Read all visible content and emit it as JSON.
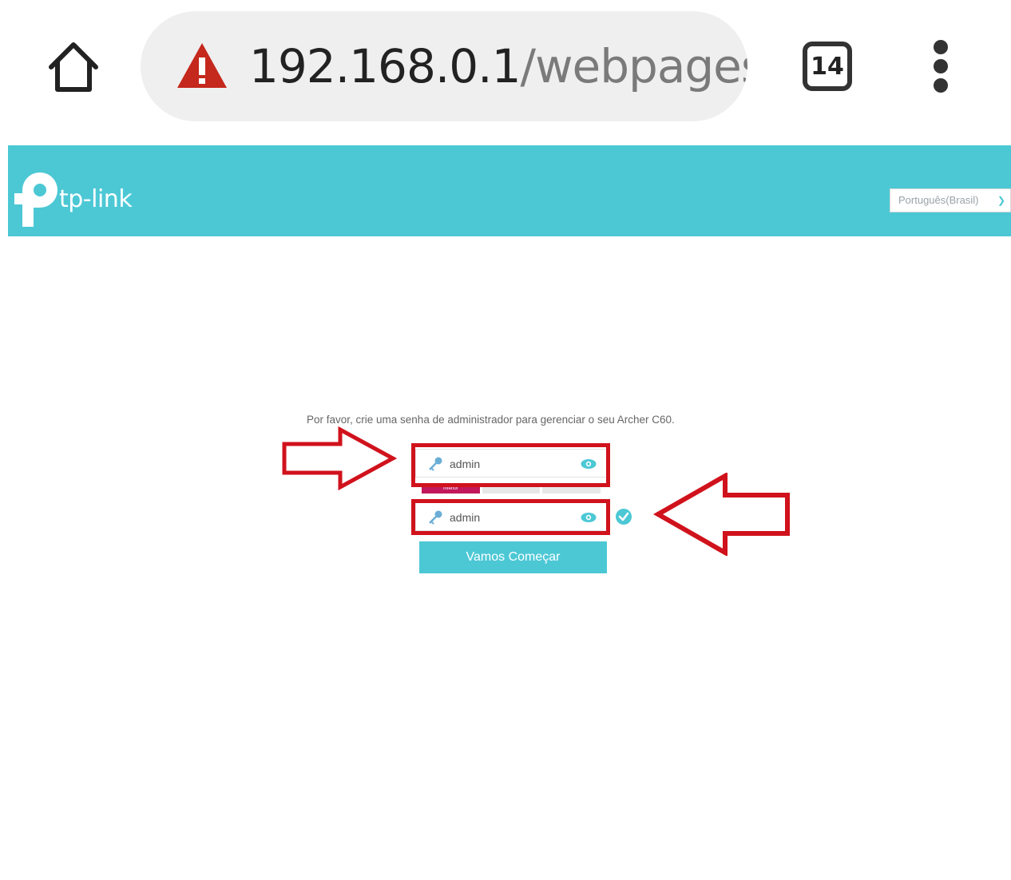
{
  "browser": {
    "url_host": "192.168.0.1",
    "url_path": "/webpages/",
    "tab_count": "14",
    "home_icon": "home-icon",
    "security_icon": "warning-triangle-icon",
    "menu_icon": "vertical-dots-icon"
  },
  "header": {
    "brand": "tp-link",
    "language": "Português(Brasil)",
    "color": "#4cc8d5"
  },
  "setup": {
    "instruction": "Por favor, crie uma senha de administrador para gerenciar o seu Archer C60.",
    "password_value": "admin",
    "confirm_value": "admin",
    "strength_levels": [
      "Inferior",
      "",
      ""
    ],
    "start_button": "Vamos Começar"
  },
  "colors": {
    "accent": "#4cc8d5",
    "annotation": "#d0121c",
    "weak": "#c2185b",
    "warning": "#c5281c"
  }
}
